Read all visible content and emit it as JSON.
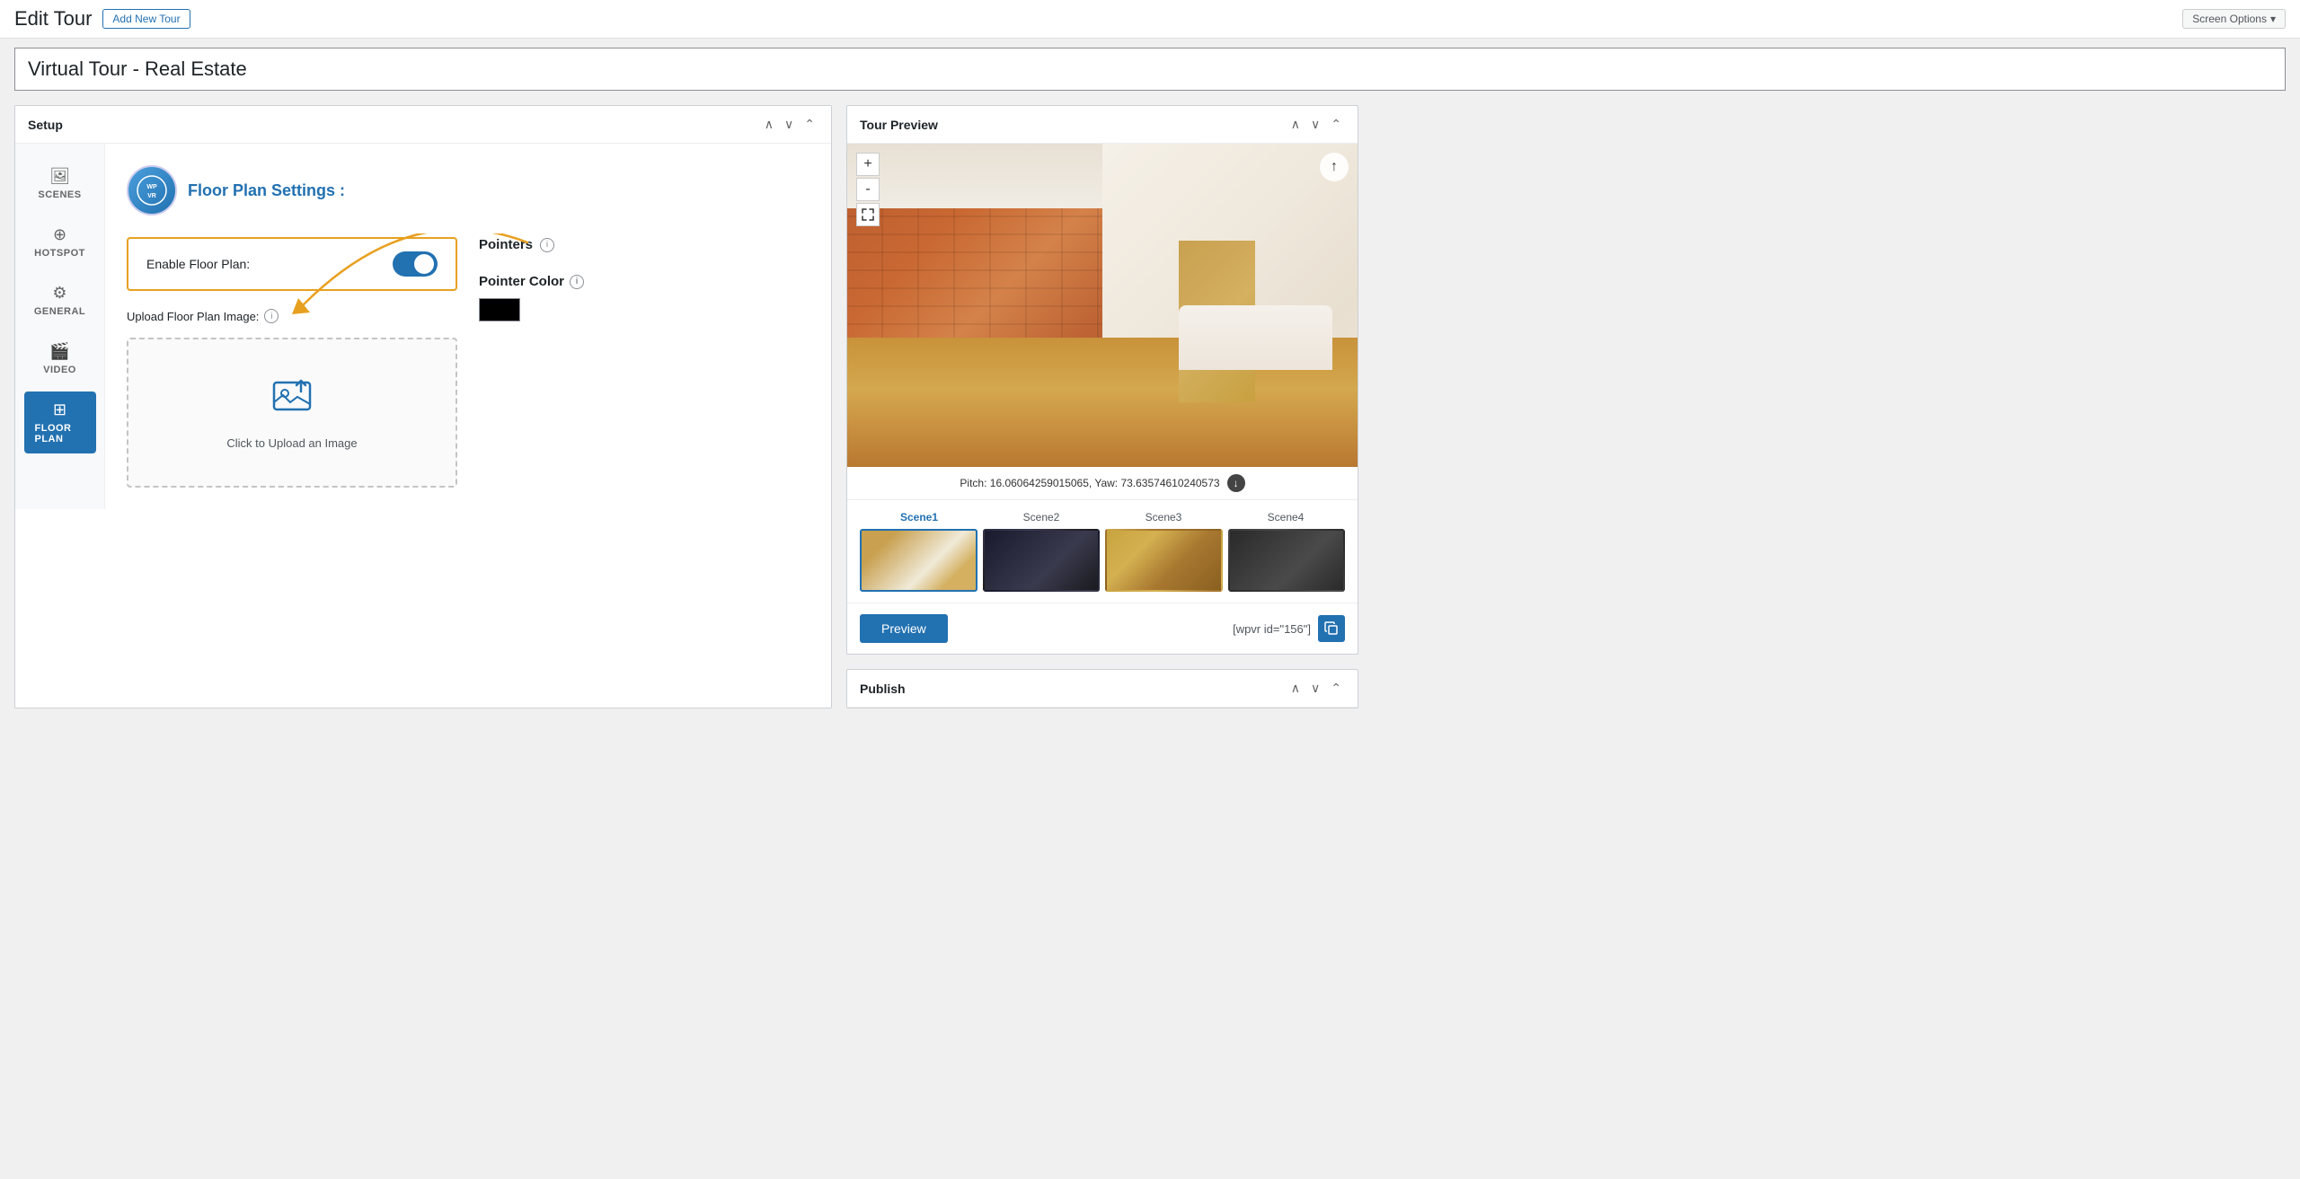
{
  "topbar": {
    "page_title": "Edit Tour",
    "add_new_label": "Add New Tour",
    "screen_options_label": "Screen Options"
  },
  "tour_title": "Virtual Tour - Real Estate",
  "setup_panel": {
    "title": "Setup",
    "controls": [
      "up",
      "down",
      "collapse"
    ]
  },
  "sidebar": {
    "items": [
      {
        "id": "scenes",
        "label": "SCENES",
        "icon": "🖼"
      },
      {
        "id": "hotspot",
        "label": "HOTSPOT",
        "icon": "⊕"
      },
      {
        "id": "general",
        "label": "GENERAL",
        "icon": "⚙"
      },
      {
        "id": "video",
        "label": "VIDEO",
        "icon": "🎬"
      },
      {
        "id": "floor_plan",
        "label": "FLOOR PLAN",
        "icon": "⊞"
      }
    ]
  },
  "floor_plan": {
    "title": "Floor Plan Settings :",
    "wpvr_logo": "WPVR",
    "enable_label": "Enable Floor Plan:",
    "enable_value": true,
    "upload_label": "Upload Floor Plan Image:",
    "upload_click_text": "Click to Upload an Image",
    "pointers_label": "Pointers",
    "pointer_color_label": "Pointer Color",
    "pointer_color_value": "#000000"
  },
  "tour_preview": {
    "title": "Tour Preview",
    "pitch_yaw_text": "Pitch: 16.06064259015065, Yaw: 73.63574610240573",
    "scenes": [
      {
        "id": "scene1",
        "label": "Scene1",
        "active": true
      },
      {
        "id": "scene2",
        "label": "Scene2",
        "active": false
      },
      {
        "id": "scene3",
        "label": "Scene3",
        "active": false
      },
      {
        "id": "scene4",
        "label": "Scene4",
        "active": false
      }
    ],
    "preview_btn_label": "Preview",
    "shortcode_text": "[wpvr id=\"156\"]",
    "zoom_in": "+",
    "zoom_out": "-"
  },
  "publish_panel": {
    "title": "Publish"
  }
}
